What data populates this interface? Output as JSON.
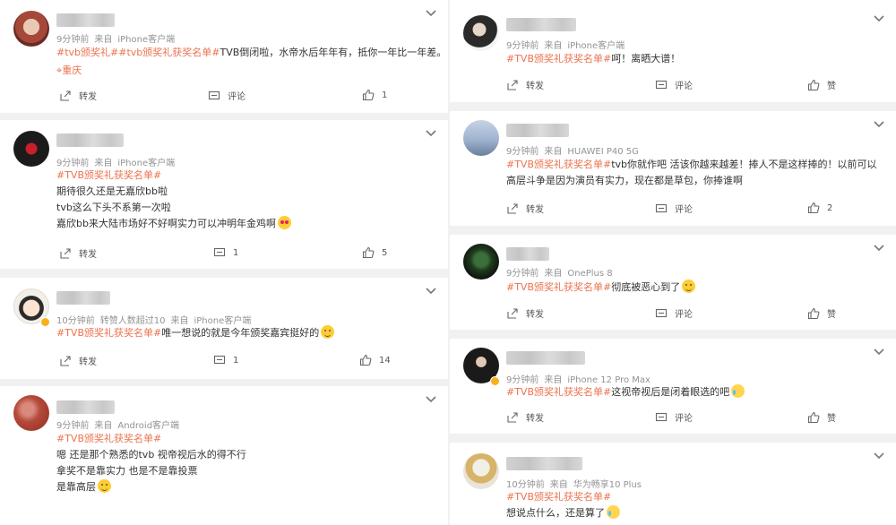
{
  "actions": {
    "repost": "转发",
    "comment": "评论",
    "like": "赞"
  },
  "posts": [
    {
      "time": "9分钟前",
      "via": "来自",
      "device": "iPhone客户端",
      "tags": "#tvb颁奖礼##tvb颁奖礼获奖名单#",
      "lines": [
        "TVB倒闭啦，水帝水后年年有，抵你一年比一年差。"
      ],
      "location": "重庆",
      "comments": "",
      "likes": "1"
    },
    {
      "time": "9分钟前",
      "via": "来自",
      "device": "iPhone客户端",
      "tags": "#TVB颁奖礼获奖名单#",
      "lines": [
        "期待很久还是无嘉欣bb啦",
        "tvb这么下头不系第一次啦",
        "嘉欣bb来大陆市场好不好啊实力可以冲明年金鸡啊"
      ],
      "emoji": "heart-eyes",
      "comments": "1",
      "likes": "5"
    },
    {
      "time": "10分钟前",
      "extra": "转赞人数超过10",
      "via": "来自",
      "device": "iPhone客户端",
      "tags": "#TVB颁奖礼获奖名单#",
      "lines": [
        "唯一想说的就是今年颁奖嘉宾挺好的"
      ],
      "emoji": "sunglasses",
      "comments": "1",
      "likes": "14"
    },
    {
      "time": "9分钟前",
      "via": "来自",
      "device": "Android客户端",
      "tags": "#TVB颁奖礼获奖名单#",
      "lines": [
        "嗯 还是那个熟悉的tvb 视帝视后水的得不行",
        "拿奖不是靠实力 也是不是靠投票",
        "是靠高层"
      ],
      "emoji": "smile"
    },
    {
      "time": "9分钟前",
      "via": "来自",
      "device": "iPhone客户端",
      "tags": "#TVB颁奖礼获奖名单#",
      "lines": [
        "呵！离晒大谱！"
      ],
      "comments": "",
      "likes": ""
    },
    {
      "time": "9分钟前",
      "via": "来自",
      "device": "HUAWEI P40 5G",
      "tags": "#TVB颁奖礼获奖名单#",
      "lines": [
        "tvb你就作吧 活该你越来越差！捧人不是这样捧的！以前可以高层斗争是因为演员有实力，现在都是草包，你捧谁啊"
      ],
      "comments": "",
      "likes": "2"
    },
    {
      "time": "9分钟前",
      "via": "来自",
      "device": "OnePlus 8",
      "tags": "#TVB颁奖礼获奖名单#",
      "lines": [
        "彻底被恶心到了"
      ],
      "emoji": "sick",
      "comments": "",
      "likes": ""
    },
    {
      "time": "9分钟前",
      "via": "来自",
      "device": "iPhone 12 Pro Max",
      "tags": "#TVB颁奖礼获奖名单#",
      "lines": [
        "这视帝视后是闭着眼选的吧"
      ],
      "emoji": "tears",
      "comments": "",
      "likes": ""
    },
    {
      "time": "10分钟前",
      "via": "来自",
      "device": "华为畅享10 Plus",
      "tags": "#TVB颁奖礼获奖名单#",
      "lines": [
        "想说点什么，还是算了"
      ],
      "emoji": "cry"
    }
  ]
}
